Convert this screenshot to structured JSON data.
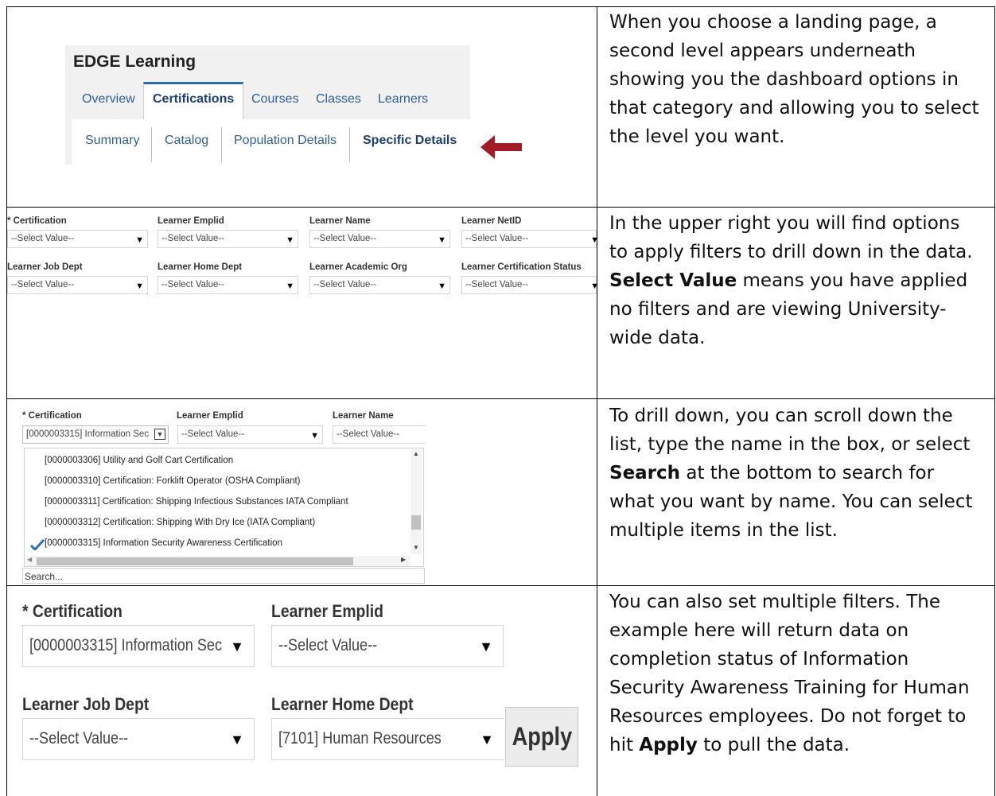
{
  "row1": {
    "app_title": "EDGE Learning",
    "tabs": [
      "Overview",
      "Certifications",
      "Courses",
      "Classes",
      "Learners"
    ],
    "subtabs": [
      "Summary",
      "Catalog",
      "Population Details",
      "Specific Details"
    ],
    "description": "When you choose a landing page, a second level appears underneath showing you the dashboard options in that category and allowing you to select the level you want.",
    "arrow_color": "#a31b27"
  },
  "row2": {
    "filters_row1": [
      {
        "label": "* Certification",
        "value": "--Select Value--"
      },
      {
        "label": "Learner Emplid",
        "value": "--Select Value--"
      },
      {
        "label": "Learner Name",
        "value": "--Select Value--"
      },
      {
        "label": "Learner NetID",
        "value": "--Select Value--"
      }
    ],
    "filters_row2": [
      {
        "label": "Learner Job Dept",
        "value": "--Select Value--"
      },
      {
        "label": "Learner Home Dept",
        "value": "--Select Value--"
      },
      {
        "label": "Learner Academic Org",
        "value": "--Select Value--"
      },
      {
        "label": "Learner Certification Status",
        "value": "--Select Value--"
      }
    ],
    "desc_part1": "In the upper right you will find options to apply filters to drill down in the data. ",
    "desc_bold": "Select Value",
    "desc_part2": " means you have applied no filters and are viewing University-wide data."
  },
  "row3": {
    "filters": [
      {
        "label": "* Certification",
        "value": "[0000003315] Information Sec"
      },
      {
        "label": "Learner Emplid",
        "value": "--Select Value--"
      },
      {
        "label": "Learner Name",
        "value": "--Select Value--"
      }
    ],
    "list_items": [
      "[0000003306] Utility and Golf Cart Certification",
      "[0000003310] Certification: Forklift Operator (OSHA Compliant)",
      "[0000003311] Certification: Shipping Infectious Substances IATA Compliant",
      "[0000003312] Certification: Shipping With Dry Ice (IATA Compliant)",
      "[0000003315] Information Security Awareness Certification"
    ],
    "selected_index": 4,
    "search_label": "Search...",
    "desc_part1": "To drill down, you can scroll down the list, type the name in the box, or select ",
    "desc_bold": "Search",
    "desc_part2": " at the bottom to search for what you want by name. You can select multiple items in the list.",
    "check_color": "#2d6fc1"
  },
  "row4": {
    "filters": [
      {
        "label": "* Certification",
        "value": "[0000003315] Information Sec"
      },
      {
        "label": "Learner Emplid",
        "value": "--Select Value--"
      },
      {
        "label": "Learner Job Dept",
        "value": "--Select Value--"
      },
      {
        "label": "Learner Home Dept",
        "value": "[7101] Human Resources"
      }
    ],
    "apply_label": "Apply",
    "desc_part1": "You can also set multiple filters. The example here will return data on completion status of Information Security Awareness Training for Human Resources employees. Do not forget to hit ",
    "desc_bold": "Apply",
    "desc_part2": " to pull the data."
  }
}
